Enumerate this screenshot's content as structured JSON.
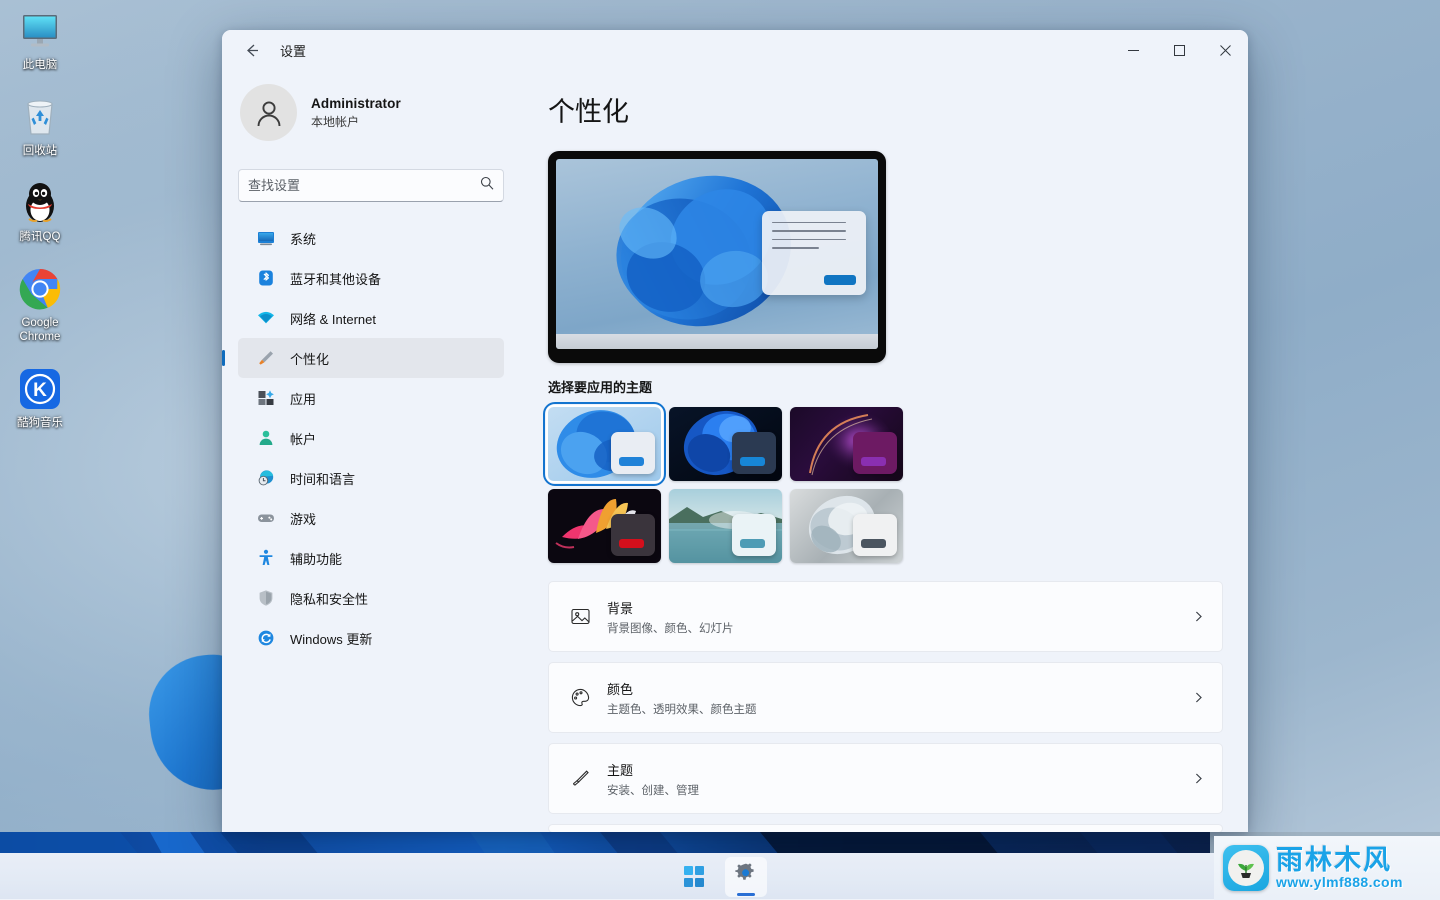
{
  "desktop": {
    "icons": [
      {
        "name": "此电脑",
        "icon": "computer-icon"
      },
      {
        "name": "回收站",
        "icon": "recycle-bin-icon"
      },
      {
        "name": "腾讯QQ",
        "icon": "qq-penguin-icon"
      },
      {
        "name": "Google Chrome",
        "icon": "chrome-icon"
      },
      {
        "name": "酷狗音乐",
        "icon": "kugou-music-icon"
      }
    ]
  },
  "taskbar": {
    "start_label": "开始",
    "settings_label": "设置"
  },
  "window": {
    "title": "设置",
    "back_label": "返回",
    "minimize_label": "最小化",
    "maximize_label": "最大化",
    "close_label": "关闭"
  },
  "sidebar": {
    "account": {
      "name": "Administrator",
      "subtitle": "本地帐户"
    },
    "search": {
      "placeholder": "查找设置",
      "value": "",
      "icon": "search-icon"
    },
    "items": [
      {
        "label": "系统",
        "icon": "system-monitor-icon",
        "selected": false
      },
      {
        "label": "蓝牙和其他设备",
        "icon": "bluetooth-icon",
        "selected": false
      },
      {
        "label": "网络 & Internet",
        "icon": "wifi-icon",
        "selected": false
      },
      {
        "label": "个性化",
        "icon": "paintbrush-icon",
        "selected": true
      },
      {
        "label": "应用",
        "icon": "apps-icon",
        "selected": false
      },
      {
        "label": "帐户",
        "icon": "account-person-icon",
        "selected": false
      },
      {
        "label": "时间和语言",
        "icon": "clock-globe-icon",
        "selected": false
      },
      {
        "label": "游戏",
        "icon": "gamepad-icon",
        "selected": false
      },
      {
        "label": "辅助功能",
        "icon": "accessibility-person-icon",
        "selected": false
      },
      {
        "label": "隐私和安全性",
        "icon": "shield-icon",
        "selected": false
      },
      {
        "label": "Windows 更新",
        "icon": "update-refresh-icon",
        "selected": false
      }
    ]
  },
  "main": {
    "page_title": "个性化",
    "themes_heading": "选择要应用的主题",
    "themes": [
      {
        "id": "windows-light",
        "selected": true,
        "accent": "#1f82d8",
        "window_bg": "#e9edf3",
        "bg_kind": "bloom-light"
      },
      {
        "id": "windows-dark",
        "selected": false,
        "accent": "#1786d6",
        "window_bg": "#2b3a52",
        "bg_kind": "bloom-dark"
      },
      {
        "id": "glow",
        "selected": false,
        "accent": "#8a2fb0",
        "window_bg": "#6d1a63",
        "bg_kind": "glow"
      },
      {
        "id": "flow",
        "selected": false,
        "accent": "#d40f1c",
        "window_bg": "#3a343c",
        "bg_kind": "flower"
      },
      {
        "id": "sunrise",
        "selected": false,
        "accent": "#4e9cb5",
        "window_bg": "#eaf3f6",
        "bg_kind": "lake"
      },
      {
        "id": "captured-motion",
        "selected": false,
        "accent": "#4b5560",
        "window_bg": "#f0f1f2",
        "bg_kind": "silk"
      }
    ],
    "settings_cards": [
      {
        "title": "背景",
        "subtitle": "背景图像、颜色、幻灯片",
        "icon": "picture-icon",
        "chevron": "chevron-right-icon"
      },
      {
        "title": "颜色",
        "subtitle": "主题色、透明效果、颜色主题",
        "icon": "palette-icon",
        "chevron": "chevron-right-icon"
      },
      {
        "title": "主题",
        "subtitle": "安装、创建、管理",
        "icon": "paintbrush-icon",
        "chevron": "chevron-right-icon"
      }
    ]
  },
  "watermark": {
    "title": "雨林木风",
    "url": "www.ylmf888.com",
    "icon": "sprout-icon"
  }
}
